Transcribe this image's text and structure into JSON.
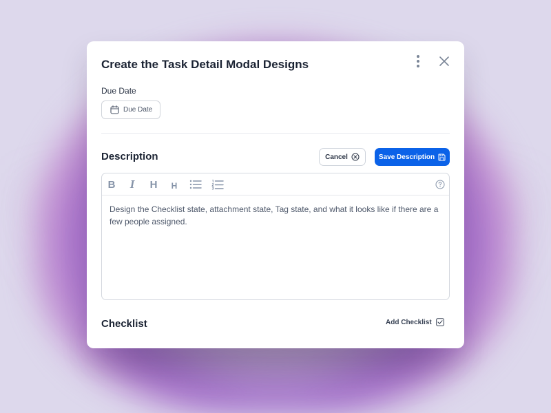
{
  "modal": {
    "title": "Create the Task Detail Modal Designs"
  },
  "due_date": {
    "label": "Due Date",
    "button_label": "Due Date"
  },
  "description": {
    "heading": "Description",
    "cancel_label": "Cancel",
    "save_label": "Save Description",
    "text": "Design the Checklist state, attachment state, Tag state, and what it looks like if there are a few people assigned."
  },
  "toolbar": {
    "bold": "B",
    "italic": "I",
    "heading1": "H",
    "heading2": "H"
  },
  "checklist": {
    "heading": "Checklist",
    "add_label": "Add Checklist"
  },
  "colors": {
    "primary": "#0b62e8",
    "text_dark": "#1b2333",
    "icon_gray": "#8593a8"
  }
}
